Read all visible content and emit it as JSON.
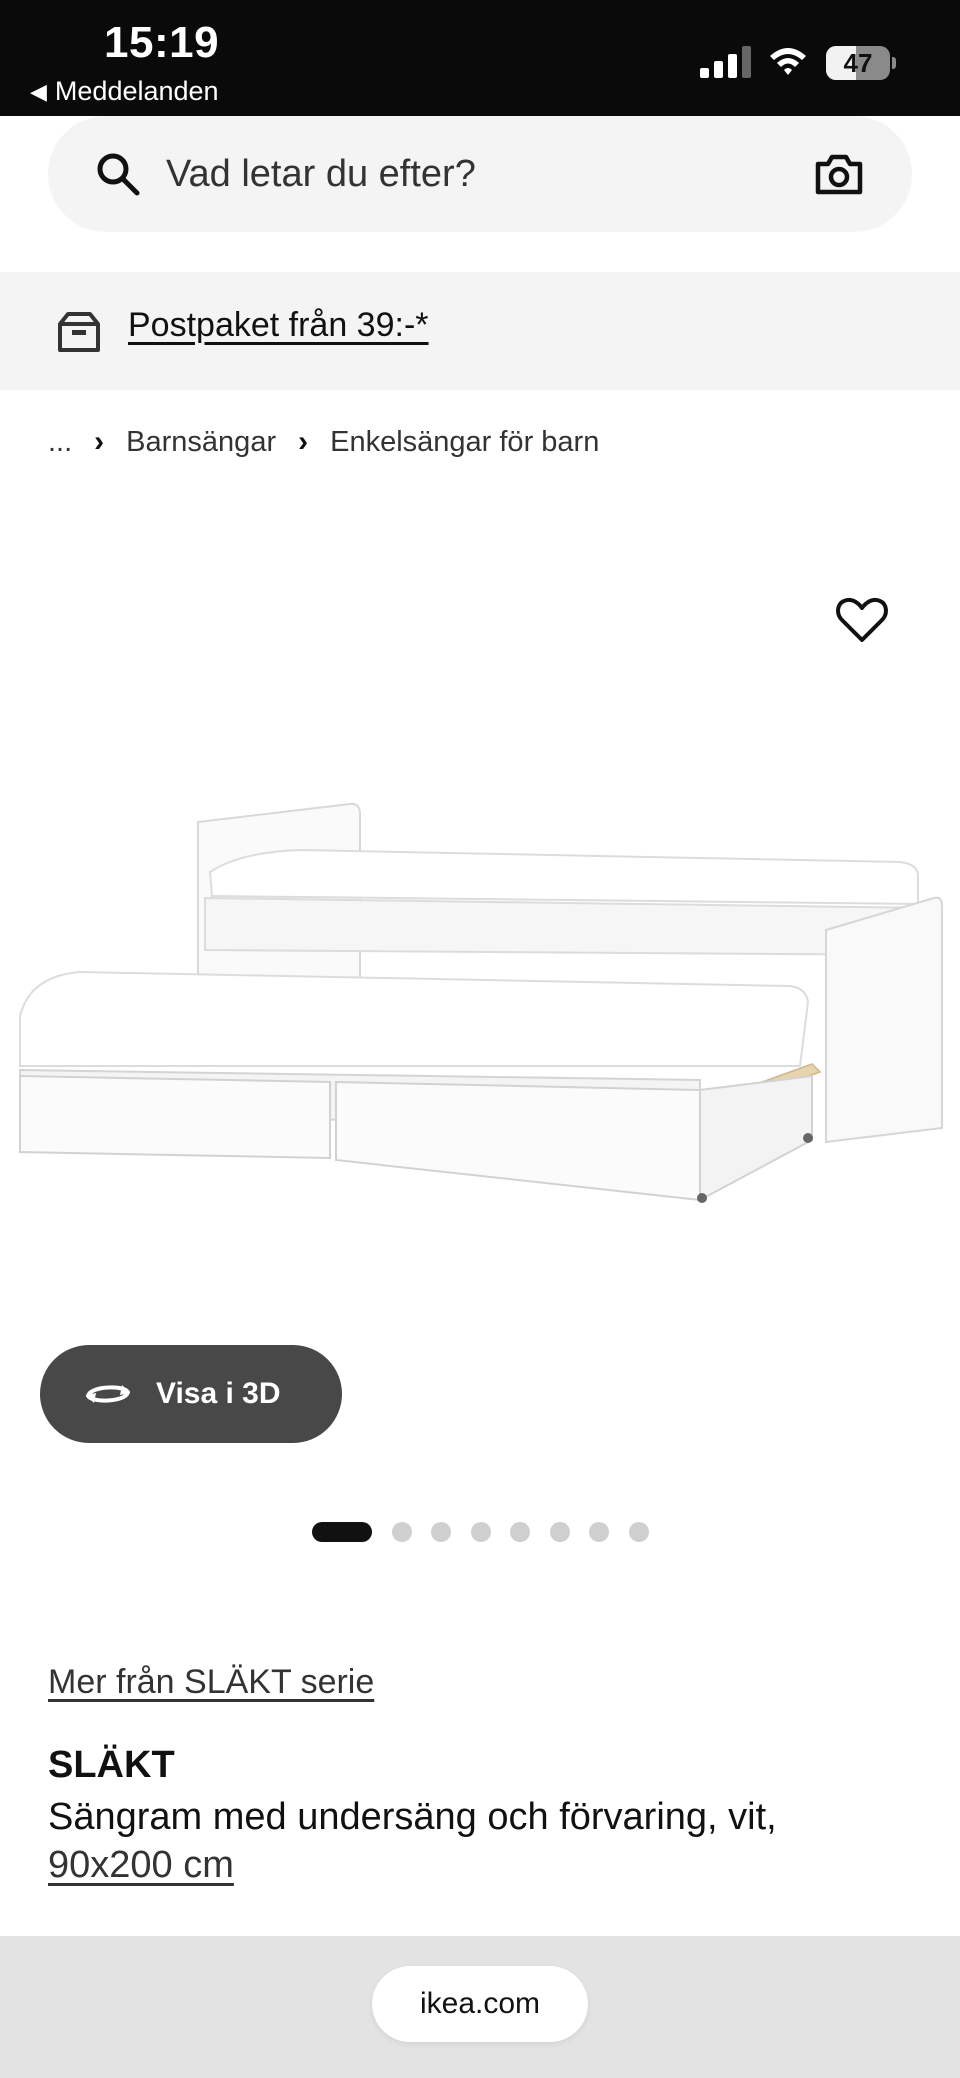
{
  "status_bar": {
    "time": "15:19",
    "back_app": "Meddelanden",
    "back_icon": "triangle-left-icon",
    "battery_level": "47",
    "battery_fraction": 0.47
  },
  "search": {
    "placeholder": "Vad letar du efter?",
    "search_icon": "search-icon",
    "camera_icon": "camera-icon"
  },
  "promo": {
    "text": "Postpaket från 39:-*",
    "icon": "package-icon"
  },
  "breadcrumb": {
    "ellipsis": "...",
    "items": [
      "Barnsängar",
      "Enkelsängar för barn"
    ]
  },
  "gallery": {
    "favorite_icon": "heart-icon",
    "view_3d_label": "Visa i 3D",
    "view_3d_icon": "rotate-icon",
    "slide_count": 8,
    "active_slide": 1
  },
  "product": {
    "series_link": "Mer från SLÄKT serie",
    "name": "SLÄKT",
    "description": "Sängram med undersäng och förvaring, vit,",
    "size": "90x200 cm"
  },
  "browser": {
    "url": "ikea.com"
  }
}
